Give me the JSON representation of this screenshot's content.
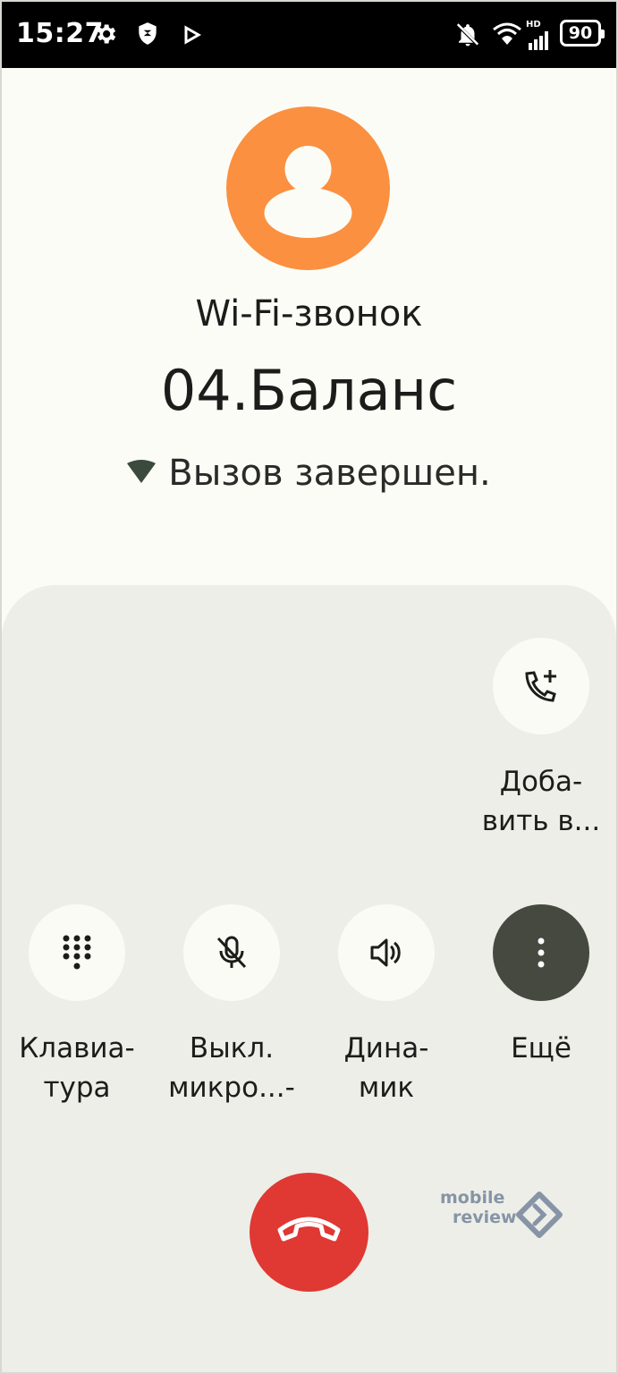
{
  "status_bar": {
    "time": "15:27",
    "battery": "90",
    "network_badge": "HD",
    "icons": [
      "gear-icon",
      "shield-icon",
      "play-store-icon",
      "bell-off-icon",
      "wifi-icon",
      "signal-icon",
      "battery-icon"
    ]
  },
  "caller": {
    "call_type": "Wi-Fi-звонок",
    "name": "04.Баланс",
    "status": "Вызов завершен.",
    "avatar_color": "#fa9040"
  },
  "controls": {
    "add_call_label": "Доба-\nвить в...",
    "keypad_label": "Клавиа-\nтура",
    "mute_label": "Выкл.\nмикро...-",
    "speaker_label": "Дина-\nмик",
    "more_label": "Ещё"
  },
  "end_call": {
    "color": "#e03833",
    "icon": "hang-up-icon"
  },
  "watermark": {
    "line1": "mobile",
    "line2": "review"
  },
  "colors": {
    "background": "#fcfcf6",
    "sheet": "#edeee7",
    "button": "#fbfbf5",
    "more_button": "#46493f"
  }
}
